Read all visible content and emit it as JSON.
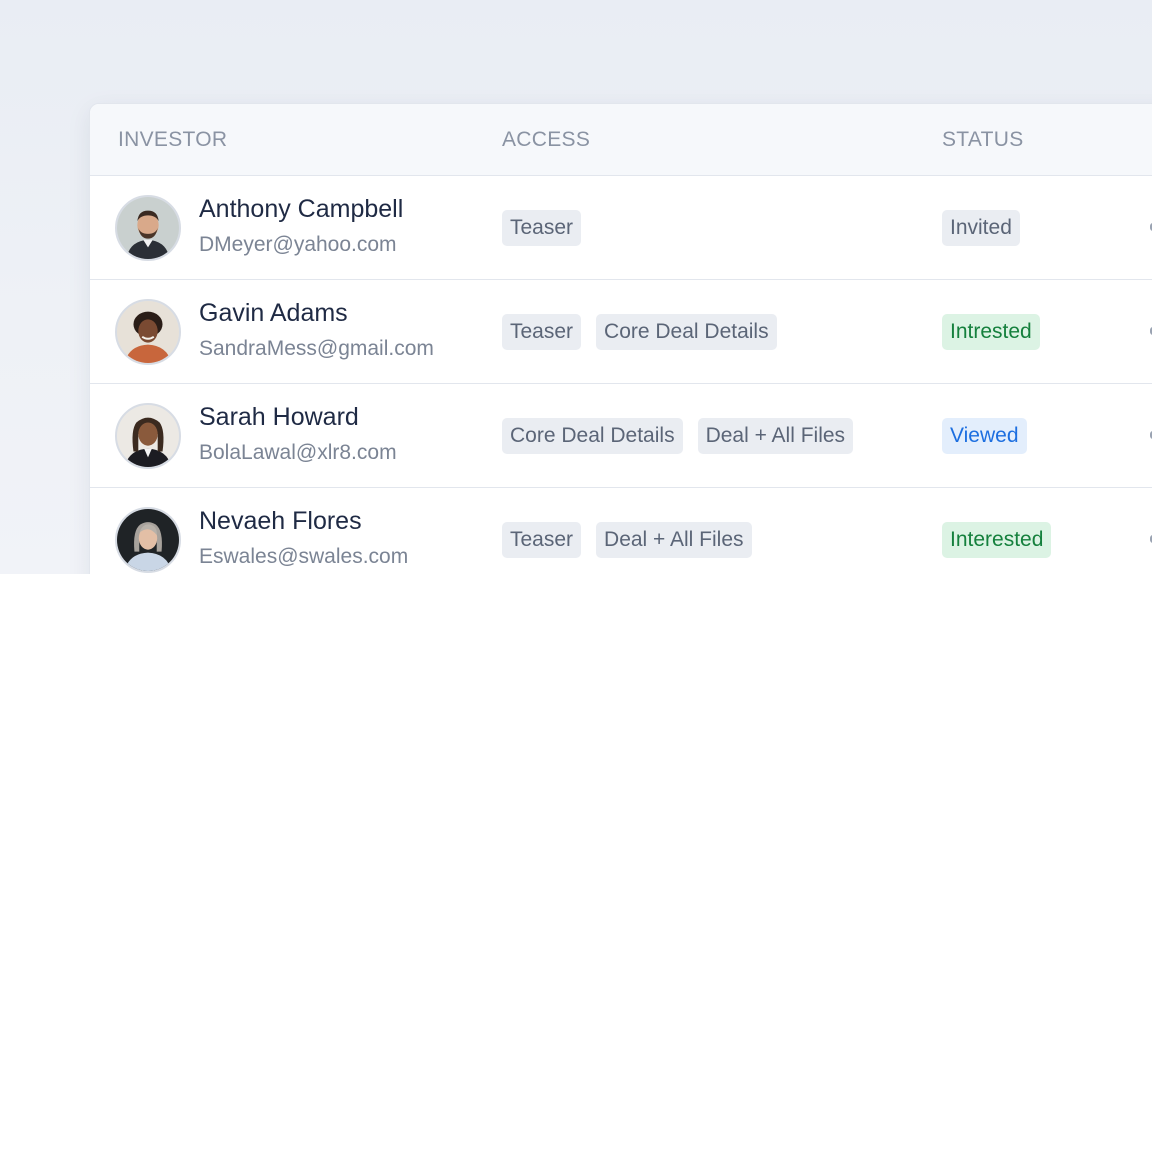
{
  "table": {
    "headers": {
      "investor": "INVESTOR",
      "access": "ACCESS",
      "status": "STATUS"
    },
    "rows": [
      {
        "name": "Anthony Campbell",
        "email": "DMeyer@yahoo.com",
        "access": [
          "Teaser"
        ],
        "status": "Invited",
        "status_color": "#5b6577",
        "status_bg": "#eaedf2",
        "avatar": "avatar-man-beard"
      },
      {
        "name": "Gavin Adams",
        "email": "SandraMess@gmail.com",
        "access": [
          "Teaser",
          "Core Deal Details"
        ],
        "status": "Intrested",
        "status_color": "#15803d",
        "status_bg": "#dcf3e4",
        "avatar": "avatar-woman-curly"
      },
      {
        "name": "Sarah Howard",
        "email": "BolaLawal@xlr8.com",
        "access": [
          "Core Deal Details",
          "Deal + All Files"
        ],
        "status": "Viewed",
        "status_color": "#1d6fe0",
        "status_bg": "#e3eefc",
        "avatar": "avatar-woman-braids"
      },
      {
        "name": "Nevaeh Flores",
        "email": "Eswales@swales.com",
        "access": [
          "Teaser",
          "Deal + All Files"
        ],
        "status": "Interested",
        "status_color": "#15803d",
        "status_bg": "#dcf3e4",
        "avatar": "avatar-woman-gray-hair"
      }
    ]
  }
}
